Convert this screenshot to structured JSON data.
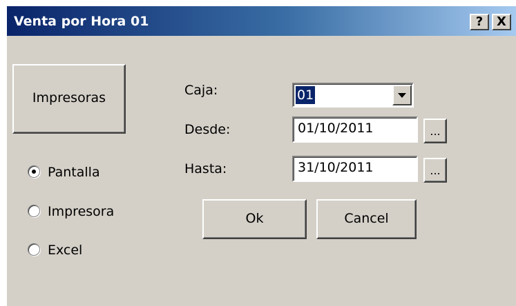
{
  "window": {
    "title": "Venta por Hora 01",
    "help_label": "?",
    "close_label": "X"
  },
  "buttons": {
    "impresoras": "Impresoras",
    "ok": "Ok",
    "cancel": "Cancel",
    "desde_picker": "...",
    "hasta_picker": "..."
  },
  "output": {
    "options": [
      {
        "label": "Pantalla",
        "checked": true
      },
      {
        "label": "Impresora",
        "checked": false
      },
      {
        "label": "Excel",
        "checked": false
      }
    ]
  },
  "form": {
    "caja_label": "Caja:",
    "caja_value": "01",
    "desde_label": "Desde:",
    "desde_value": "01/10/2011",
    "hasta_label": "Hasta:",
    "hasta_value": "31/10/2011"
  },
  "colors": {
    "titlebar_start": "#0a246a",
    "titlebar_end": "#a6caf0",
    "face": "#d4d0c8",
    "selection": "#0a246a"
  },
  "icons": {
    "help": "help-icon",
    "close": "close-icon",
    "dropdown": "chevron-down-icon"
  }
}
